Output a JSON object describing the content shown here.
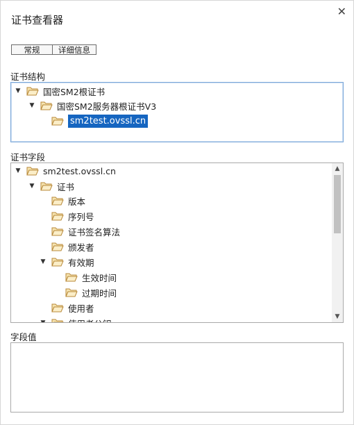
{
  "dialog": {
    "title": "证书查看器",
    "close_glyph": "✕"
  },
  "tabs": [
    {
      "label": "常规"
    },
    {
      "label": "详细信息"
    }
  ],
  "structure": {
    "label": "证书结构",
    "nodes": [
      {
        "text": "国密SM2根证书"
      },
      {
        "text": "国密SM2服务器根证书V3"
      },
      {
        "text": "sm2test.ovssl.cn",
        "selected": true
      }
    ]
  },
  "fields": {
    "label": "证书字段",
    "nodes": [
      {
        "text": "sm2test.ovssl.cn"
      },
      {
        "text": "证书"
      },
      {
        "text": "版本"
      },
      {
        "text": "序列号"
      },
      {
        "text": "证书签名算法"
      },
      {
        "text": "颁发者"
      },
      {
        "text": "有效期"
      },
      {
        "text": "生效时间"
      },
      {
        "text": "过期时间"
      },
      {
        "text": "使用者"
      },
      {
        "text": "使用者公钥"
      }
    ]
  },
  "value": {
    "label": "字段值",
    "content": ""
  },
  "icons": {
    "expanded": "▼",
    "folder": "folder-icon",
    "scroll_up": "▲",
    "scroll_down": "▼"
  }
}
